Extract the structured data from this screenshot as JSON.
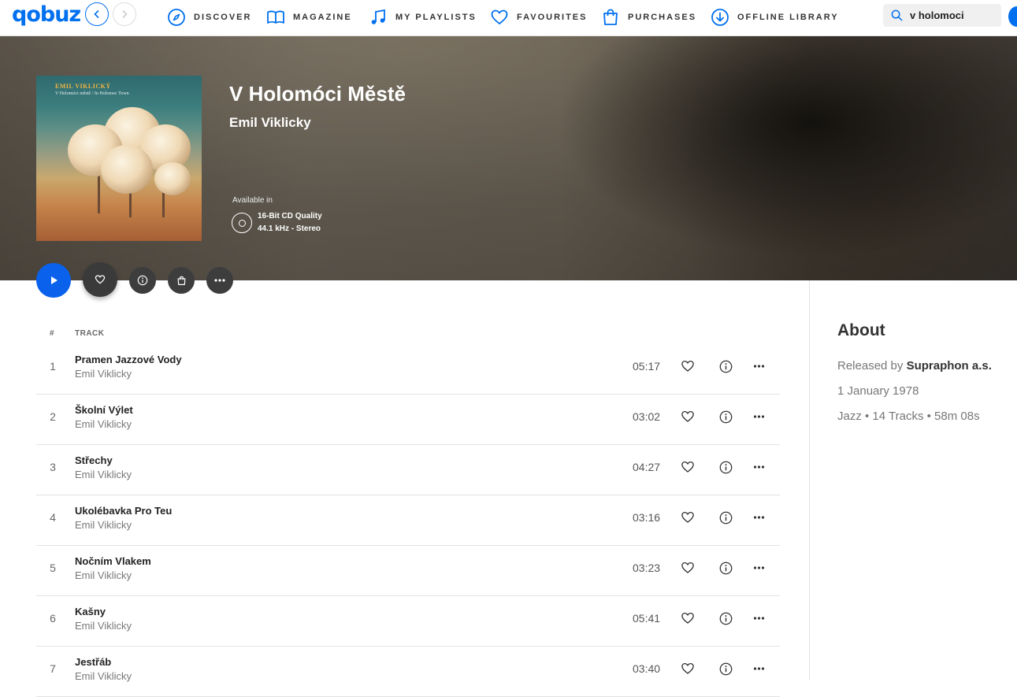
{
  "app": {
    "logo": "qobuz"
  },
  "nav": {
    "items": [
      {
        "label": "DISCOVER",
        "icon": "compass-icon"
      },
      {
        "label": "MAGAZINE",
        "icon": "book-icon"
      },
      {
        "label": "MY PLAYLISTS",
        "icon": "music-note-icon"
      },
      {
        "label": "FAVOURITES",
        "icon": "heart-icon"
      },
      {
        "label": "PURCHASES",
        "icon": "shopping-bag-icon"
      },
      {
        "label": "OFFLINE LIBRARY",
        "icon": "download-icon"
      }
    ],
    "search": {
      "value": "v holomoci"
    }
  },
  "album": {
    "title": "V Holomóci Městě",
    "artist": "Emil Viklicky",
    "cover_artist": "EMIL VIKLICKÝ",
    "cover_title": "V Holomóci městě / In Holomoc Town",
    "available_label": "Available in",
    "quality_line1": "16-Bit CD Quality",
    "quality_line2": "44.1 kHz - Stereo"
  },
  "tracklist": {
    "header_num": "#",
    "header_track": "TRACK",
    "tracks": [
      {
        "num": "1",
        "title": "Pramen Jazzové Vody",
        "artist": "Emil Viklicky",
        "duration": "05:17"
      },
      {
        "num": "2",
        "title": "Školní Výlet",
        "artist": "Emil Viklicky",
        "duration": "03:02"
      },
      {
        "num": "3",
        "title": "Střechy",
        "artist": "Emil Viklicky",
        "duration": "04:27"
      },
      {
        "num": "4",
        "title": "Ukolébavka Pro Teu",
        "artist": "Emil Viklicky",
        "duration": "03:16"
      },
      {
        "num": "5",
        "title": "Nočním Vlakem",
        "artist": "Emil Viklicky",
        "duration": "03:23"
      },
      {
        "num": "6",
        "title": "Kašny",
        "artist": "Emil Viklicky",
        "duration": "05:41"
      },
      {
        "num": "7",
        "title": "Jestřáb",
        "artist": "Emil Viklicky",
        "duration": "03:40"
      }
    ]
  },
  "about": {
    "heading": "About",
    "released_by_label": "Released by",
    "label": "Supraphon a.s.",
    "release_date": "1 January 1978",
    "summary": "Jazz • 14 Tracks • 58m 08s"
  },
  "colors": {
    "accent": "#0070ef",
    "play": "#0a62ec"
  }
}
